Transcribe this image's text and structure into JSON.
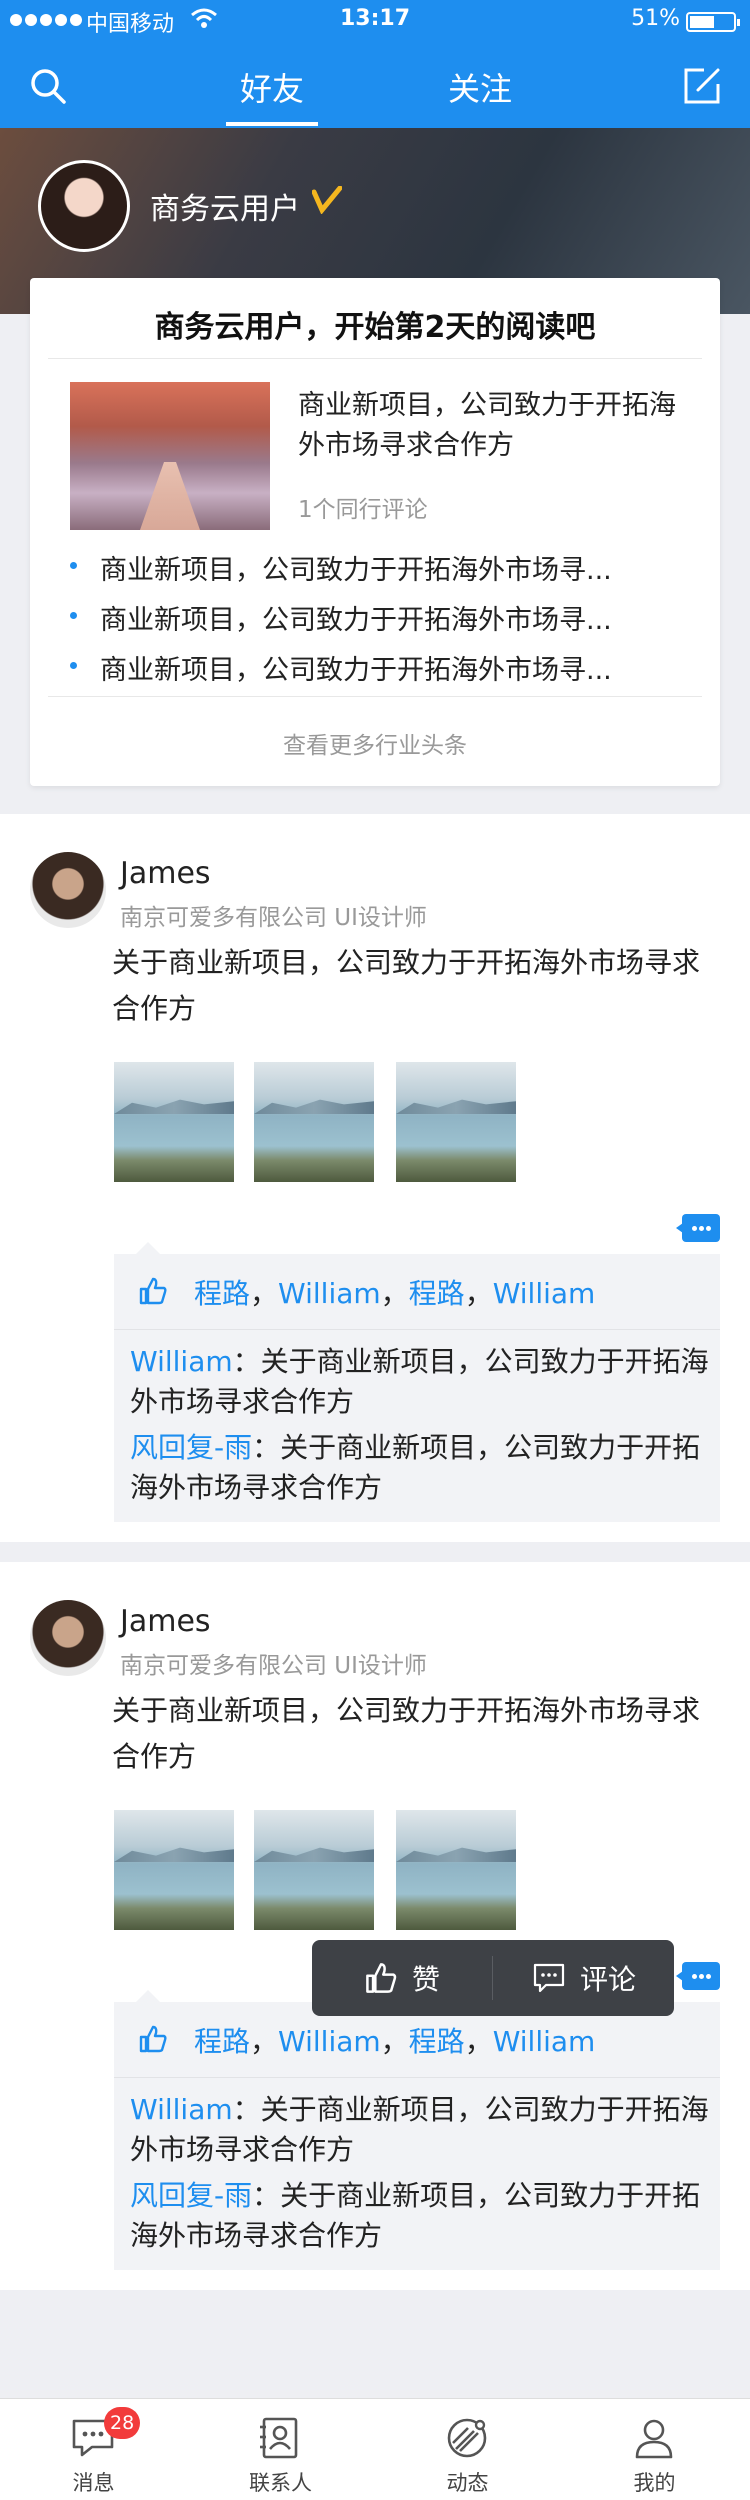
{
  "status_bar": {
    "carrier": "中国移动",
    "time": "13:17",
    "battery": "51%"
  },
  "nav": {
    "tab_friends": "好友",
    "tab_follow": "关注",
    "active_tab": "好友"
  },
  "banner": {
    "username": "商务云用户"
  },
  "reading_card": {
    "title": "商务云用户，开始第2天的阅读吧",
    "headline": "商业新项目，公司致力于开拓海外市场寻求合作方",
    "subline": "1个同行评论",
    "bullets": [
      "商业新项目，公司致力于开拓海外市场寻...",
      "商业新项目，公司致力于开拓海外市场寻...",
      "商业新项目，公司致力于开拓海外市场寻..."
    ],
    "more_link": "查看更多行业头条"
  },
  "posts": [
    {
      "name": "James",
      "company": "南京可爱多有限公司 UI设计师",
      "content": "关于商业新项目，公司致力于开拓海外市场寻求合作方",
      "likes": [
        "程路",
        "William",
        "程路",
        "William"
      ],
      "separator": "，",
      "replies": [
        {
          "author": "William",
          "text": "：关于商业新项目，公司致力于开拓海外市场寻求合作方"
        },
        {
          "author": "风回复-雨",
          "text": "：关于商业新项目，公司致力于开拓海外市场寻求合作方"
        }
      ]
    },
    {
      "name": "James",
      "company": "南京可爱多有限公司 UI设计师",
      "content": "关于商业新项目，公司致力于开拓海外市场寻求合作方",
      "likes": [
        "程路",
        "William",
        "程路",
        "William"
      ],
      "separator": "，",
      "replies": [
        {
          "author": "William",
          "text": "：关于商业新项目，公司致力于开拓海外市场寻求合作方"
        },
        {
          "author": "风回复-雨",
          "text": "：关于商业新项目，公司致力于开拓海外市场寻求合作方"
        }
      ]
    }
  ],
  "action_popup": {
    "like": "赞",
    "comment": "评论"
  },
  "tabbar": {
    "items": [
      {
        "label": "消息",
        "icon": "message-icon",
        "badge": "28"
      },
      {
        "label": "联系人",
        "icon": "contacts-icon"
      },
      {
        "label": "动态",
        "icon": "moments-icon"
      },
      {
        "label": "我的",
        "icon": "profile-icon"
      }
    ]
  },
  "colors": {
    "primary": "#1e8eef",
    "badge": "#f23b3b",
    "popup": "#3e4146"
  }
}
